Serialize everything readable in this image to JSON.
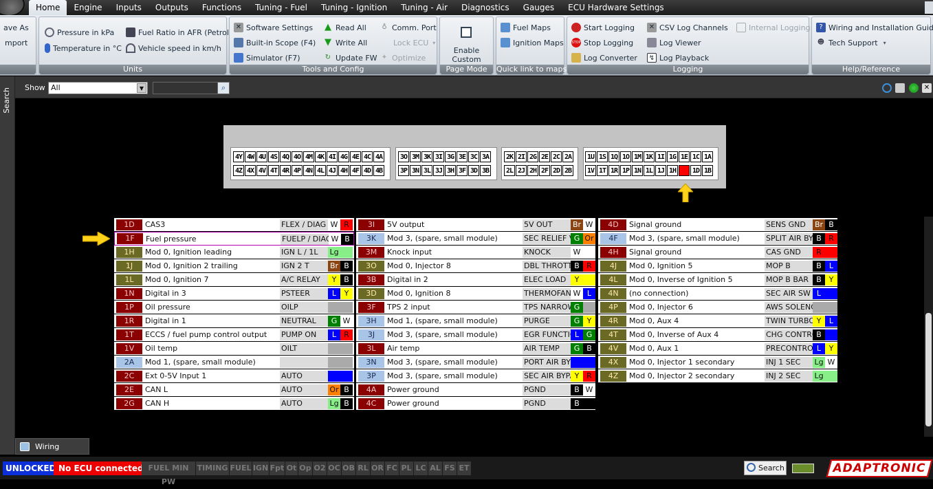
{
  "menu": {
    "tabs": [
      "Home",
      "Engine",
      "Inputs",
      "Outputs",
      "Functions",
      "Tuning - Fuel",
      "Tuning - Ignition",
      "Tuning - Air",
      "Diagnostics",
      "Gauges",
      "ECU Hardware Settings"
    ],
    "active": "Home"
  },
  "ribbon": {
    "file": {
      "save_as": "ave As",
      "import": "mport"
    },
    "units": {
      "label": "Units",
      "pressure": "Pressure in kPa",
      "temperature": "Temperature in °C",
      "fuel_ratio": "Fuel Ratio in AFR (Petrol)",
      "vehicle_speed": "Vehicle speed in km/h"
    },
    "tools": {
      "label": "Tools and Config",
      "software_settings": "Software Settings",
      "builtin_scope": "Built-in Scope (F4)",
      "simulator": "Simulator (F7)",
      "read_all": "Read All",
      "write_all": "Write All",
      "update_fw": "Update FW",
      "comm_port": "Comm. Port",
      "lock_ecu": "Lock ECU",
      "optimize": "Optimize"
    },
    "page_mode": {
      "label": "Page Mode",
      "enable_custom_view": "Enable Custom View"
    },
    "quick_link": {
      "label": "Quick link to maps",
      "fuel_maps": "Fuel Maps",
      "ignition_maps": "Ignition Maps"
    },
    "logging": {
      "label": "Logging",
      "start_logging": "Start Logging",
      "stop_logging": "Stop Logging",
      "log_converter": "Log Converter",
      "csv_log_channels": "CSV Log Channels",
      "log_viewer": "Log Viewer",
      "log_playback": "Log Playback",
      "internal_logging": "Internal Logging"
    },
    "help": {
      "label": "Help/Reference",
      "wiring_guide": "Wiring and Installation Guide",
      "tech_support": "Tech Support"
    }
  },
  "side": {
    "search_tab": "Search"
  },
  "filter": {
    "show_label": "Show",
    "show_value": "All",
    "search_value": ""
  },
  "connector": {
    "plug1": {
      "top": [
        "4Y",
        "4W",
        "4U",
        "4S",
        "4Q",
        "4O",
        "4M",
        "4K",
        "4I",
        "4G",
        "4E",
        "4C",
        "4A"
      ],
      "bottom": [
        "4Z",
        "4X",
        "4V",
        "4T",
        "4R",
        "4P",
        "4N",
        "4L",
        "4J",
        "4H",
        "4F",
        "4D",
        "4B"
      ]
    },
    "plug2": {
      "top": [
        "3O",
        "3M",
        "3K",
        "3I",
        "3G",
        "3E",
        "3C",
        "3A"
      ],
      "bottom": [
        "3P",
        "3N",
        "3L",
        "3J",
        "3H",
        "3F",
        "3D",
        "3B"
      ]
    },
    "plug3": {
      "top": [
        "2K",
        "2I",
        "2G",
        "2E",
        "2C",
        "2A"
      ],
      "bottom": [
        "2L",
        "2J",
        "2H",
        "2F",
        "2D",
        "2B"
      ]
    },
    "plug4": {
      "top": [
        "1U",
        "1S",
        "1Q",
        "1O",
        "1M",
        "1K",
        "1I",
        "1G",
        "1E",
        "1C",
        "1A"
      ],
      "bottom": [
        "1V",
        "1T",
        "1R",
        "1P",
        "1N",
        "1L",
        "1J",
        "1H",
        "",
        "1D",
        "1B"
      ]
    },
    "selected_pin": "1F"
  },
  "pins": {
    "col1": [
      {
        "id": "1D",
        "desc": "CAS3",
        "name": "FLEX / DIAG",
        "c1": "W",
        "c2": "R",
        "bg1": "#ffffff",
        "bg2": "#ff0000",
        "idc": "red"
      },
      {
        "id": "1F",
        "desc": "Fuel pressure",
        "name": "FUELP / DIAG",
        "c1": "W",
        "c2": "B",
        "bg1": "#ffffff",
        "bg2": "#000000",
        "idc": "red",
        "selected": true
      },
      {
        "id": "1H",
        "desc": "Mod 0, Ignition leading",
        "name": "IGN L / 1L",
        "c1": "Lg",
        "c2": "",
        "bg1": "#88ee88",
        "bg2": "#88ee88",
        "idc": "olive"
      },
      {
        "id": "1J",
        "desc": "Mod 0, Ignition 2 trailing",
        "name": "IGN 2 T",
        "c1": "Br",
        "c2": "B",
        "bg1": "#8b4513",
        "bg2": "#000000",
        "idc": "olive"
      },
      {
        "id": "1L",
        "desc": "Mod 0, Ignition 7",
        "name": "A/C RELAY",
        "c1": "Y",
        "c2": "B",
        "bg1": "#ffff00",
        "bg2": "#000000",
        "idc": "olive"
      },
      {
        "id": "1N",
        "desc": "Digital in 3",
        "name": "PSTEER",
        "c1": "L",
        "c2": "Y",
        "bg1": "#0000ff",
        "bg2": "#ffff00",
        "idc": "red"
      },
      {
        "id": "1P",
        "desc": "Oil pressure",
        "name": "OILP",
        "c1": "",
        "c2": "",
        "bg1": "#aaaaaa",
        "bg2": "#aaaaaa",
        "idc": "red"
      },
      {
        "id": "1R",
        "desc": "Digital in 1",
        "name": "NEUTRAL",
        "c1": "G",
        "c2": "W",
        "bg1": "#008000",
        "bg2": "#ffffff",
        "idc": "red"
      },
      {
        "id": "1T",
        "desc": "ECCS / fuel pump control output",
        "name": "PUMP ON",
        "c1": "L",
        "c2": "R",
        "bg1": "#0000ff",
        "bg2": "#ff0000",
        "idc": "red"
      },
      {
        "id": "1V",
        "desc": "Oil temp",
        "name": "OILT",
        "c1": "",
        "c2": "",
        "bg1": "#aaaaaa",
        "bg2": "#aaaaaa",
        "idc": "red"
      },
      {
        "id": "2A",
        "desc": "Mod 1, (spare, small module)",
        "name": "",
        "c1": "",
        "c2": "",
        "bg1": "#aaaaaa",
        "bg2": "#aaaaaa",
        "idc": "lightblue"
      },
      {
        "id": "2C",
        "desc": "Ext 0-5V Input 1",
        "name": "AUTO",
        "c1": "",
        "c2": "",
        "bg1": "#0000ff",
        "bg2": "#0000ff",
        "idc": "red"
      },
      {
        "id": "2E",
        "desc": "CAN L",
        "name": "AUTO",
        "c1": "Or",
        "c2": "B",
        "bg1": "#ff8000",
        "bg2": "#000000",
        "idc": "red"
      },
      {
        "id": "2G",
        "desc": "CAN H",
        "name": "AUTO",
        "c1": "Lg",
        "c2": "B",
        "bg1": "#88ee88",
        "bg2": "#000000",
        "idc": "red"
      }
    ],
    "col2": [
      {
        "id": "3I",
        "desc": "5V output",
        "name": "5V OUT",
        "c1": "Br",
        "c2": "W",
        "bg1": "#8b4513",
        "bg2": "#ffffff",
        "idc": "red"
      },
      {
        "id": "3K",
        "desc": "Mod 3, (spare, small module)",
        "name": "SEC RELIEF V",
        "c1": "G",
        "c2": "Or",
        "bg1": "#008000",
        "bg2": "#ff8000",
        "idc": "lightblue"
      },
      {
        "id": "3M",
        "desc": "Knock input",
        "name": "KNOCK",
        "c1": "W",
        "c2": "",
        "bg1": "#ffffff",
        "bg2": "#ffffff",
        "idc": "red"
      },
      {
        "id": "3O",
        "desc": "Mod 0, Injector 8",
        "name": "DBL THROTTL",
        "c1": "B",
        "c2": "R",
        "bg1": "#000000",
        "bg2": "#ff0000",
        "idc": "olive"
      },
      {
        "id": "3B",
        "desc": "Digital in 2",
        "name": "ELEC LOAD",
        "c1": "Y",
        "c2": "",
        "bg1": "#ffff00",
        "bg2": "#ffff00",
        "idc": "red"
      },
      {
        "id": "3D",
        "desc": "Mod 0, Ignition 8",
        "name": "THERMOFAN",
        "c1": "W",
        "c2": "L",
        "bg1": "#ffffff",
        "bg2": "#0000ff",
        "idc": "olive"
      },
      {
        "id": "3F",
        "desc": "TPS 2 input",
        "name": "TPS NARROW",
        "c1": "G",
        "c2": "",
        "bg1": "#008000",
        "bg2": "#aaaaaa",
        "idc": "red"
      },
      {
        "id": "3H",
        "desc": "Mod 1, (spare, small module)",
        "name": "PURGE",
        "c1": "G",
        "c2": "Y",
        "bg1": "#008000",
        "bg2": "#ffff00",
        "idc": "lightblue"
      },
      {
        "id": "3J",
        "desc": "Mod 3, (spare, small module)",
        "name": "EGR FUNCTIC",
        "c1": "L",
        "c2": "G",
        "bg1": "#0000ff",
        "bg2": "#008000",
        "idc": "lightblue"
      },
      {
        "id": "3L",
        "desc": "Air temp",
        "name": "AIR TEMP",
        "c1": "G",
        "c2": "B",
        "bg1": "#008000",
        "bg2": "#000000",
        "idc": "red"
      },
      {
        "id": "3N",
        "desc": "Mod 3, (spare, small module)",
        "name": "PORT AIR BYF",
        "c1": "",
        "c2": "",
        "bg1": "#0000ff",
        "bg2": "#0000ff",
        "idc": "lightblue"
      },
      {
        "id": "3P",
        "desc": "Mod 3, (spare, small module)",
        "name": "SEC AIR BYPA",
        "c1": "Y",
        "c2": "R",
        "bg1": "#ffff00",
        "bg2": "#ff0000",
        "idc": "lightblue"
      },
      {
        "id": "4A",
        "desc": "Power ground",
        "name": "PGND",
        "c1": "B",
        "c2": "W",
        "bg1": "#000000",
        "bg2": "#ffffff",
        "idc": "red"
      },
      {
        "id": "4C",
        "desc": "Power ground",
        "name": "PGND",
        "c1": "B",
        "c2": "",
        "bg1": "#000000",
        "bg2": "#000000",
        "idc": "red"
      }
    ],
    "col3": [
      {
        "id": "4D",
        "desc": "Signal ground",
        "name": "SENS GND",
        "c1": "Br",
        "c2": "B",
        "bg1": "#8b4513",
        "bg2": "#000000",
        "idc": "red"
      },
      {
        "id": "4F",
        "desc": "Mod 3, (spare, small module)",
        "name": "SPLIT AIR BYF",
        "c1": "B",
        "c2": "R",
        "bg1": "#000000",
        "bg2": "#ff0000",
        "idc": "lightblue"
      },
      {
        "id": "4H",
        "desc": "Signal ground",
        "name": "CAS GND",
        "c1": "R",
        "c2": "",
        "bg1": "#ff0000",
        "bg2": "#ff0000",
        "idc": "red"
      },
      {
        "id": "4J",
        "desc": "Mod 0, Ignition 5",
        "name": "MOP B",
        "c1": "B",
        "c2": "L",
        "bg1": "#000000",
        "bg2": "#0000ff",
        "idc": "olive"
      },
      {
        "id": "4L",
        "desc": "Mod 0, Inverse of Ignition 5",
        "name": "MOP B BAR",
        "c1": "B",
        "c2": "Y",
        "bg1": "#000000",
        "bg2": "#ffff00",
        "idc": "olive"
      },
      {
        "id": "4N",
        "desc": "(no connection)",
        "name": "SEC AIR SW V",
        "c1": "L",
        "c2": "",
        "bg1": "#0000ff",
        "bg2": "#0000ff",
        "idc": "olive"
      },
      {
        "id": "4P",
        "desc": "Mod 0, Injector 6",
        "name": "AWS SOLENO",
        "c1": "",
        "c2": "",
        "bg1": "#aaaaaa",
        "bg2": "#aaaaaa",
        "idc": "olive"
      },
      {
        "id": "4R",
        "desc": "Mod 0, Aux 4",
        "name": "TWIN TURBO",
        "c1": "Y",
        "c2": "L",
        "bg1": "#ffff00",
        "bg2": "#0000ff",
        "idc": "olive"
      },
      {
        "id": "4T",
        "desc": "Mod 0, Inverse of Aux 4",
        "name": "CHG CONTRO",
        "c1": "B",
        "c2": "",
        "bg1": "#000000",
        "bg2": "#0000ff",
        "idc": "olive"
      },
      {
        "id": "4V",
        "desc": "Mod 0, Aux 1",
        "name": "PRECONTROL",
        "c1": "L",
        "c2": "Y",
        "bg1": "#0000ff",
        "bg2": "#ffff00",
        "idc": "olive"
      },
      {
        "id": "4X",
        "desc": "Mod 0, Injector 1 secondary",
        "name": "INJ 1 SEC",
        "c1": "Lg",
        "c2": "W",
        "bg1": "#88ee88",
        "bg2": "#ffffff",
        "idc": "olive"
      },
      {
        "id": "4Z",
        "desc": "Mod 0, Injector 2 secondary",
        "name": "INJ 2 SEC",
        "c1": "Lg",
        "c2": "",
        "bg1": "#88ee88",
        "bg2": "#88ee88",
        "idc": "olive"
      }
    ]
  },
  "bottom": {
    "tab": "Wiring Diagram"
  },
  "status": {
    "unlocked": "UNLOCKED",
    "ecu": "No ECU connected",
    "flags": [
      "FUEL MIN PW",
      "TIMING",
      "FUEL",
      "IGN",
      "Fpt",
      "Ot",
      "Op",
      "O2",
      "OC",
      "OB",
      "RL",
      "OR",
      "FC",
      "PL",
      "LC",
      "AL",
      "FS",
      "ET"
    ],
    "search": "Search",
    "logo": "ADAPTRONIC"
  }
}
